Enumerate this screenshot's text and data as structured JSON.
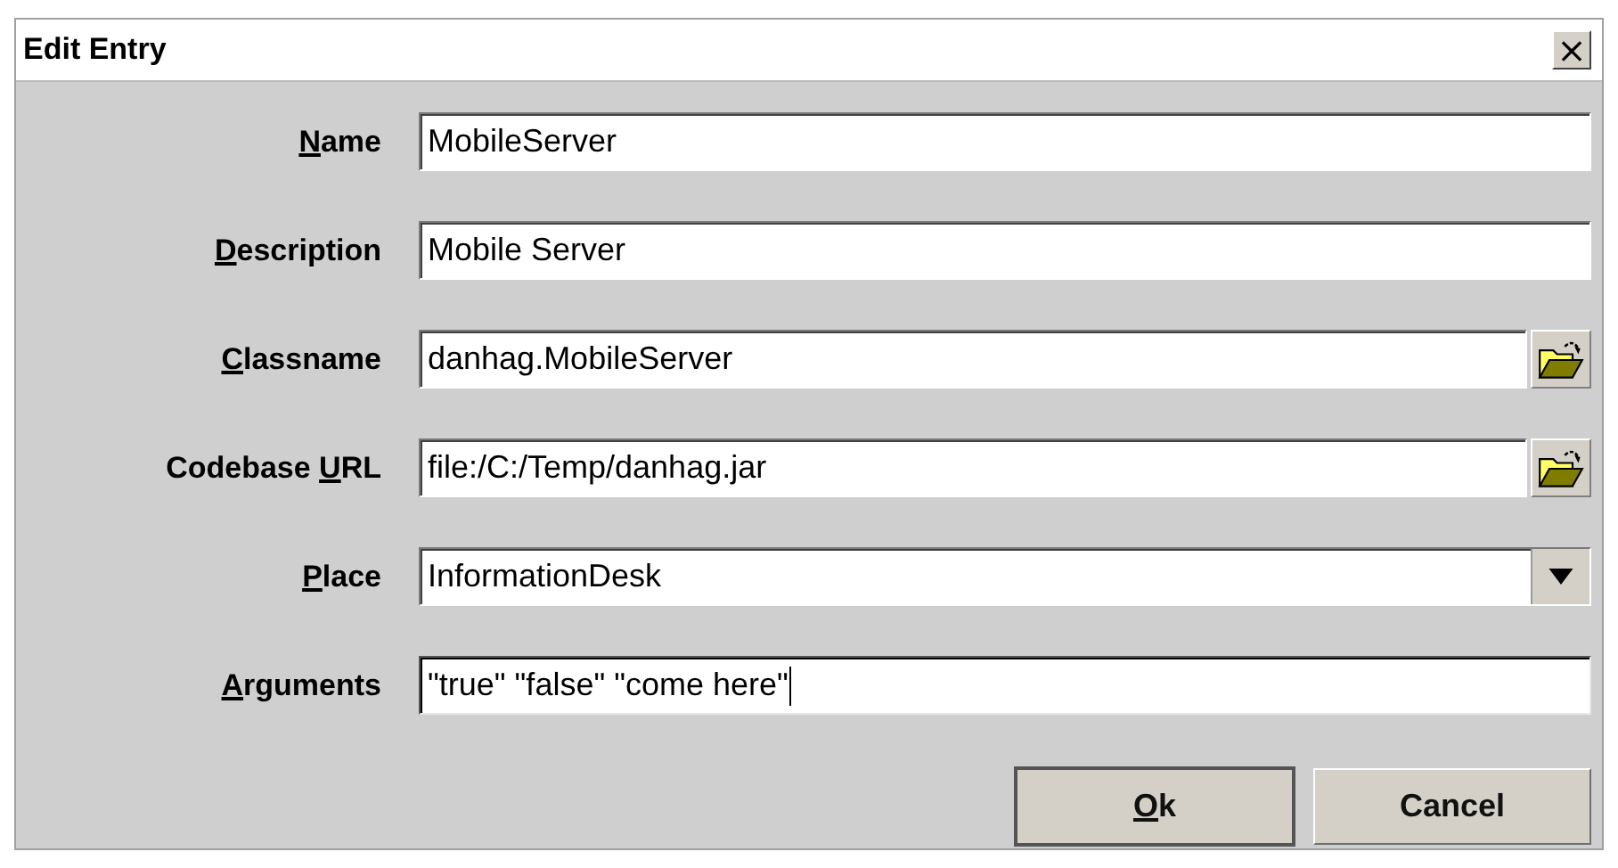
{
  "window": {
    "title": "Edit Entry",
    "close": "×"
  },
  "fields": [
    {
      "kind": "text",
      "label": [
        {
          "text": "N",
          "underline": true
        },
        {
          "text": "ame",
          "underline": false
        }
      ],
      "value": "MobileServer",
      "focused": false
    },
    {
      "kind": "text",
      "label": [
        {
          "text": "D",
          "underline": true
        },
        {
          "text": "escription",
          "underline": false
        }
      ],
      "value": "Mobile Server",
      "focused": false
    },
    {
      "kind": "file",
      "label": [
        {
          "text": "C",
          "underline": true
        },
        {
          "text": "lassname",
          "underline": false
        }
      ],
      "value": "danhag.MobileServer",
      "focused": false
    },
    {
      "kind": "file",
      "label": [
        {
          "text": "Codebase ",
          "underline": false
        },
        {
          "text": "U",
          "underline": true
        },
        {
          "text": "RL",
          "underline": false
        }
      ],
      "value": "file:/C:/Temp/danhag.jar",
      "focused": false
    },
    {
      "kind": "choice",
      "label": [
        {
          "text": "P",
          "underline": true
        },
        {
          "text": "lace",
          "underline": false
        }
      ],
      "value": "InformationDesk",
      "focused": false
    },
    {
      "kind": "text",
      "label": [
        {
          "text": "A",
          "underline": true
        },
        {
          "text": "rguments",
          "underline": false
        }
      ],
      "value": "\"true\" \"false\" \"come here\"",
      "focused": true
    }
  ],
  "buttons": [
    {
      "label": [
        {
          "text": "O",
          "underline": true
        },
        {
          "text": "k",
          "underline": false
        }
      ],
      "default": true
    },
    {
      "label": [
        {
          "text": "Cancel",
          "underline": false
        }
      ],
      "default": false
    }
  ]
}
